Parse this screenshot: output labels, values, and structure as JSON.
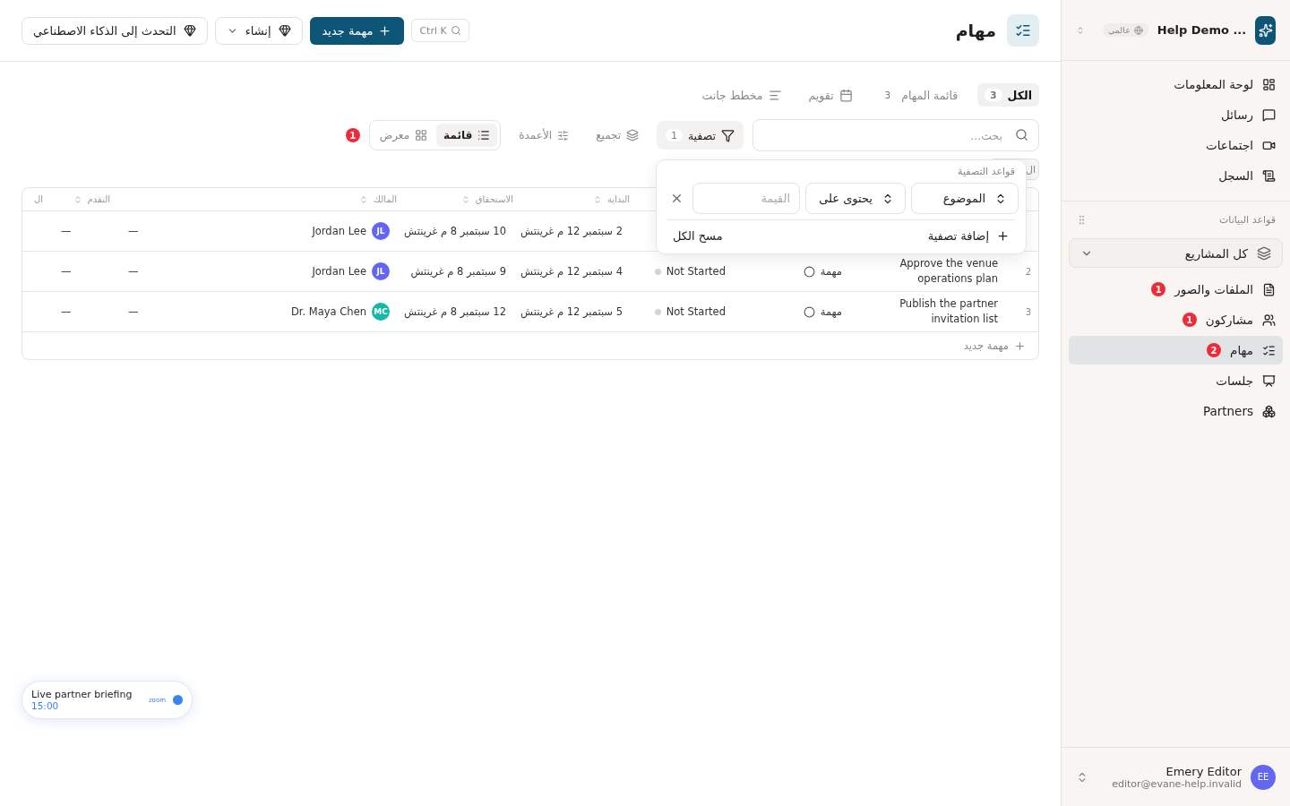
{
  "header": {
    "title": "مهام",
    "search_shortcut": "Ctrl K",
    "new_button": "مهمة جديد",
    "create_button": "إنشاء",
    "ai_button": "التحدث إلى الذكاء الاصطناعي"
  },
  "view_tabs": [
    {
      "label": "الكل",
      "count": "3",
      "kind": "count",
      "selected": true
    },
    {
      "label": "قائمة المهام",
      "count": "3",
      "kind": "count",
      "selected": false
    },
    {
      "label": "تقويم",
      "kind": "calendar",
      "selected": false
    },
    {
      "label": "مخطط جانت",
      "kind": "gantt",
      "selected": false
    }
  ],
  "toolbar": {
    "search_placeholder": "بحث...",
    "filter_label": "تصفية",
    "filter_count": "1",
    "group_label": "تجميع",
    "columns_label": "الأعمدة",
    "views": [
      {
        "label": "قائمة",
        "kind": "list",
        "selected": true
      },
      {
        "label": "معرض",
        "kind": "grid",
        "selected": false
      }
    ],
    "alert_count": "1"
  },
  "active_filter_chip": "ال",
  "filter_popover": {
    "title": "قواعد التصفية",
    "field": "الموضوع",
    "operator": "يحتوى على",
    "value_placeholder": "القيمة",
    "add_filter": "إضافة تصفية",
    "clear_all": "مسح الكل"
  },
  "table": {
    "columns": [
      {
        "label": "البداية",
        "sortable": true
      },
      {
        "label": "الاستحقاق",
        "sortable": true
      },
      {
        "label": "المالك",
        "sortable": true
      },
      {
        "label": "التقدم",
        "sortable": true
      },
      {
        "label": "ال",
        "sortable": false
      }
    ],
    "rows": [
      {
        "start": "2 سبتمبر 12 م غرينتش",
        "due": "10 سبتمبر 8 م غرينتش",
        "owner": "Jordan Lee",
        "initials": "JL",
        "color": "#6366f1",
        "column_8": "—",
        "column_9": "—"
      },
      {
        "number": "2",
        "title": "Approve the venue operations plan",
        "type": "مهمة",
        "done": false,
        "status": "Not Started",
        "start": "4 سبتمبر 12 م غرينتش",
        "due": "9 سبتمبر 8 م غرينتش",
        "owner": "Jordan Lee",
        "initials": "JL",
        "color": "#6366f1",
        "column_8": "—",
        "column_9": "—"
      },
      {
        "number": "3",
        "title": "Publish the partner invitation list",
        "type": "مهمة",
        "done": false,
        "status": "Not Started",
        "start": "5 سبتمبر 12 م غرينتش",
        "due": "12 سبتمبر 8 م غرينتش",
        "owner": "Dr. Maya Chen",
        "initials": "MC",
        "color": "#14b8a6",
        "column_8": "—",
        "column_9": "—"
      }
    ],
    "add_row": "مهمة جديد"
  },
  "meeting_widget": {
    "title": "Live partner briefing",
    "time": "15:00",
    "provider": "zoom"
  },
  "sidebar": {
    "workspace": "Help Demo ...",
    "scope": "عالمي",
    "nav": [
      {
        "label": "لوحة المعلومات",
        "kind": "dashboard"
      },
      {
        "label": "رسائل",
        "kind": "messages"
      },
      {
        "label": "اجتماعات",
        "kind": "meetings"
      },
      {
        "label": "السجل",
        "kind": "log"
      }
    ],
    "section_title": "قواعد البيانات",
    "project_selector": "كل المشاريع",
    "items": [
      {
        "label": "الملفات والصور",
        "kind": "files",
        "badge": "1",
        "selected": false
      },
      {
        "label": "مشاركون",
        "kind": "people",
        "badge": "1",
        "selected": false
      },
      {
        "label": "مهام",
        "kind": "tasks",
        "badge": "2",
        "selected": true
      },
      {
        "label": "جلسات",
        "kind": "sessions",
        "selected": false
      },
      {
        "label": "Partners",
        "kind": "partners",
        "selected": false
      }
    ],
    "user": {
      "name": "Emery Editor",
      "email": "editor@evane-help.invalid",
      "initials": "EE"
    }
  }
}
